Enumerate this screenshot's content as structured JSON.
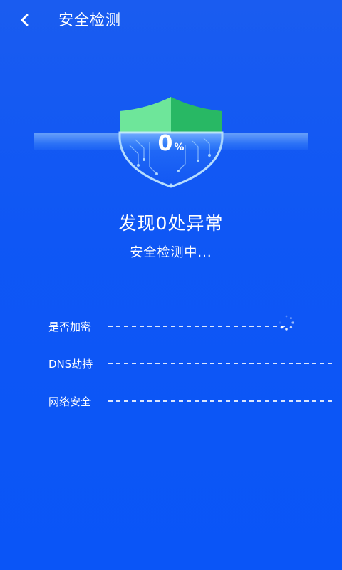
{
  "header": {
    "title": "安全检测",
    "back_icon": "chevron-left-icon"
  },
  "scan": {
    "percent_value": "0",
    "percent_symbol": "%",
    "shield_icon": "circuit-shield-icon"
  },
  "result": {
    "headline": "发现0处异常",
    "status": "安全检测中..."
  },
  "checks": [
    {
      "label": "是否加密",
      "state": "loading"
    },
    {
      "label": "DNS劫持",
      "state": "pending"
    },
    {
      "label": "网络安全",
      "state": "pending"
    }
  ],
  "colors": {
    "background": "#0f57f5",
    "shield_light": "#6ee69a",
    "shield_dark": "#28b864"
  }
}
